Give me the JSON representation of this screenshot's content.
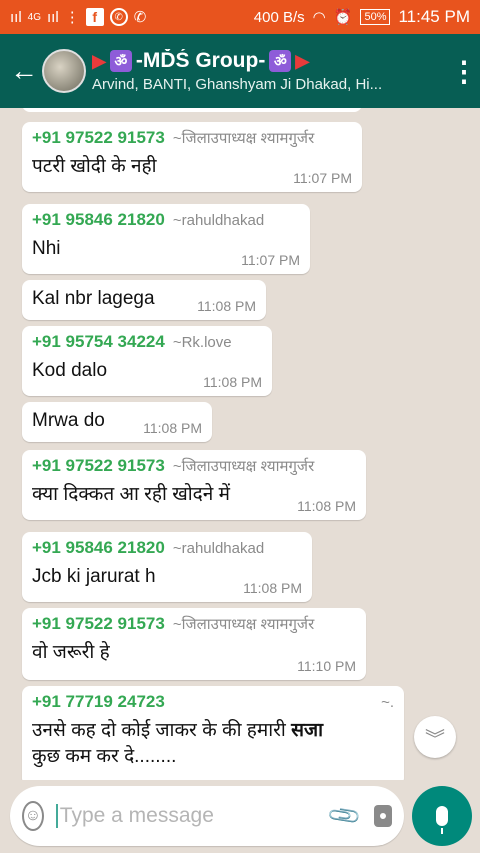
{
  "status_bar": {
    "signal_1": "ııl",
    "network_type": "4G",
    "signal_2": "ııl",
    "net_speed": "400 B/s",
    "battery": "50%",
    "time": "11:45 PM"
  },
  "header": {
    "group_name": "-MĎŚ Group-",
    "members": "Arvind, BANTI, Ghanshyam Ji Dhakad, Hi..."
  },
  "messages": [
    {
      "phone": "+91 97522 91573",
      "alias": "~जिलाउपाध्यक्ष श्यामगुर्जर",
      "text": "पटरी खोदी के नही",
      "time": "11:07 PM"
    },
    {
      "phone": "+91 95846 21820",
      "alias": "~rahuldhakad",
      "text": "Nhi",
      "time": "11:07 PM"
    },
    {
      "text": "Kal nbr lagega",
      "time": "11:08 PM"
    },
    {
      "phone": "+91 95754 34224",
      "alias": "~Rk.love",
      "text": "Kod dalo",
      "time": "11:08 PM"
    },
    {
      "text": "Mrwa do",
      "time": "11:08 PM"
    },
    {
      "phone": "+91 97522 91573",
      "alias": "~जिलाउपाध्यक्ष श्यामगुर्जर",
      "text": "क्या दिक्कत आ रही खोदने में",
      "time": "11:08 PM"
    },
    {
      "phone": "+91 95846 21820",
      "alias": "~rahuldhakad",
      "text": "Jcb ki jarurat h",
      "time": "11:08 PM"
    },
    {
      "phone": "+91 97522 91573",
      "alias": "~जिलाउपाध्यक्ष श्यामगुर्जर",
      "text": "वो जरूरी हे",
      "time": "11:10 PM"
    },
    {
      "phone": "+91 77719 24723",
      "alias": "~.",
      "text_line1": "उनसे कह दो कोई जाकर के की हमारी",
      "text_bold": "सजा",
      "text_line2": "कुछ कम कर दे........"
    }
  ],
  "input": {
    "placeholder": "Type a message"
  }
}
